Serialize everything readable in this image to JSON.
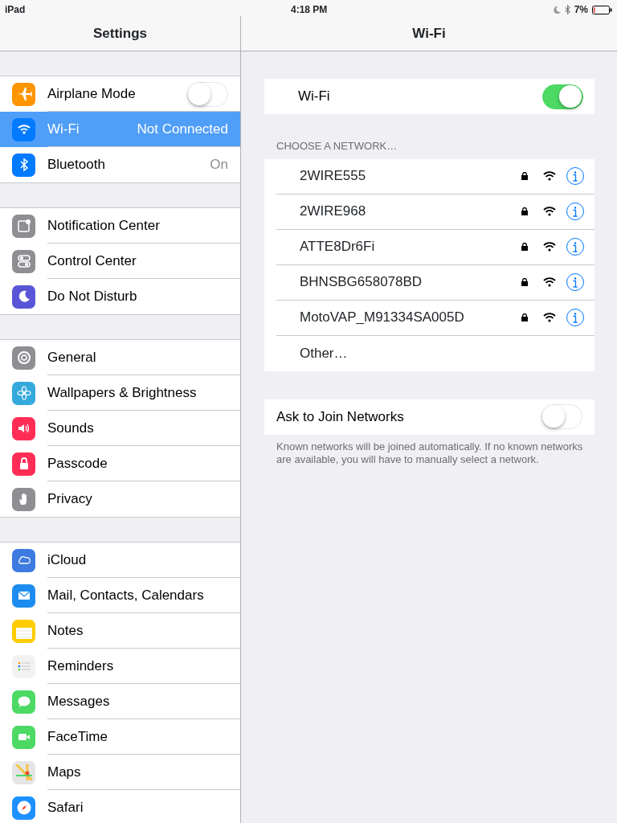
{
  "status_bar": {
    "device": "iPad",
    "time": "4:18 PM",
    "battery": "7%"
  },
  "sidebar": {
    "title": "Settings",
    "groups": [
      [
        {
          "kind": "toggle",
          "label": "Airplane Mode",
          "on": false,
          "color": "#ff9500",
          "selected": false
        },
        {
          "kind": "value",
          "label": "Wi-Fi",
          "value": "Not Connected",
          "color": "#007aff",
          "selected": true
        },
        {
          "kind": "value",
          "label": "Bluetooth",
          "value": "On",
          "color": "#007aff",
          "selected": false
        }
      ],
      [
        {
          "kind": "plain",
          "label": "Notification Center",
          "color": "#8e8e93",
          "selected": false
        },
        {
          "kind": "plain",
          "label": "Control Center",
          "color": "#8e8e93",
          "selected": false
        },
        {
          "kind": "plain",
          "label": "Do Not Disturb",
          "color": "#5856d6",
          "selected": false
        }
      ],
      [
        {
          "kind": "plain",
          "label": "General",
          "color": "#8e8e93",
          "selected": false
        },
        {
          "kind": "plain",
          "label": "Wallpapers & Brightness",
          "color": "#34aadc",
          "selected": false
        },
        {
          "kind": "plain",
          "label": "Sounds",
          "color": "#ff2d55",
          "selected": false
        },
        {
          "kind": "plain",
          "label": "Passcode",
          "color": "#ff2d55",
          "selected": false
        },
        {
          "kind": "plain",
          "label": "Privacy",
          "color": "#8e8e93",
          "selected": false
        }
      ],
      [
        {
          "kind": "plain",
          "label": "iCloud",
          "color": "#3d7be0",
          "selected": false
        },
        {
          "kind": "plain",
          "label": "Mail, Contacts, Calendars",
          "color": "#1d8cf0",
          "selected": false
        },
        {
          "kind": "plain",
          "label": "Notes",
          "color": "#ffcc00",
          "selected": false
        },
        {
          "kind": "plain",
          "label": "Reminders",
          "color": "#f2f2f2",
          "selected": false
        },
        {
          "kind": "plain",
          "label": "Messages",
          "color": "#4cd964",
          "selected": false
        },
        {
          "kind": "plain",
          "label": "FaceTime",
          "color": "#4cd964",
          "selected": false
        },
        {
          "kind": "plain",
          "label": "Maps",
          "color": "#e5e5e5",
          "selected": false
        },
        {
          "kind": "plain",
          "label": "Safari",
          "color": "#1e90ff",
          "selected": false
        }
      ]
    ]
  },
  "detail": {
    "title": "Wi-Fi",
    "wifi": {
      "label": "Wi-Fi",
      "on": true
    },
    "networks_header": "CHOOSE A NETWORK…",
    "networks": [
      {
        "name": "2WIRE555",
        "secured": true
      },
      {
        "name": "2WIRE968",
        "secured": true
      },
      {
        "name": "ATTE8Dr6Fi",
        "secured": true
      },
      {
        "name": "BHNSBG658078BD",
        "secured": true
      },
      {
        "name": "MotoVAP_M91334SA005D",
        "secured": true
      }
    ],
    "other": "Other…",
    "ask_to_join": {
      "label": "Ask to Join Networks",
      "on": false
    },
    "footer": "Known networks will be joined automatically. If no known networks are available, you will have to manually select a network."
  }
}
